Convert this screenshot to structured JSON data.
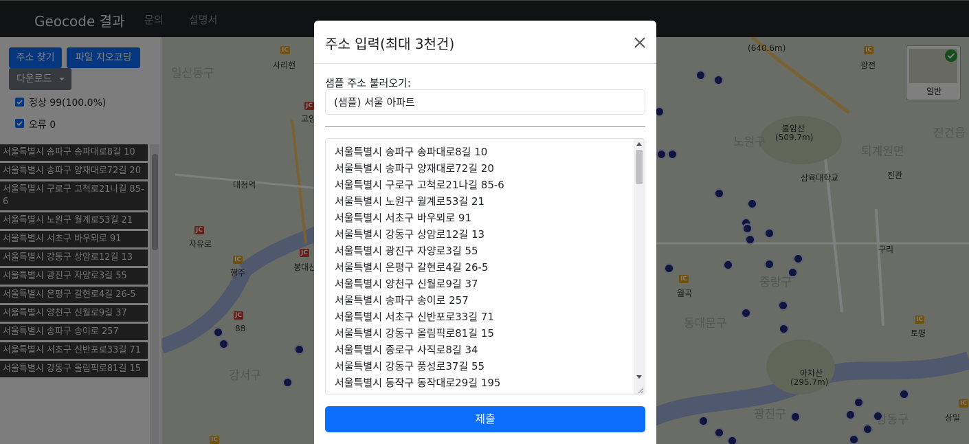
{
  "navbar": {
    "brand": "Geocode 결과",
    "links": [
      "문의",
      "설명서"
    ]
  },
  "sidebar": {
    "buttons": {
      "address_search": "주소 찾기",
      "file_geocoding": "파일 지오코딩",
      "download": "다운로드"
    },
    "filters": [
      {
        "label": "정상 99(100.0%)",
        "checked": true
      },
      {
        "label": "오류 0",
        "checked": true
      }
    ],
    "results": [
      "서울특별시 송파구 송파대로8길 10",
      "서울특별시 송파구 양재대로72길 20",
      "서울특별시 구로구 고척로21나길 85-6",
      "서울특별시 노원구 월계로53길 21",
      "서울특별시 서초구 바우뫼로 91",
      "서울특별시 강동구 상암로12길 13",
      "서울특별시 광진구 자양로3길 55",
      "서울특별시 은평구 갈현로4길 26-5",
      "서울특별시 양천구 신월로9길 37",
      "서울특별시 송파구 송이로 257",
      "서울특별시 서초구 신반포로33길 71",
      "서울특별시 강동구 올림픽로81길 15"
    ]
  },
  "map": {
    "labels": {
      "ilsan": "일산동구",
      "sari": "사리현",
      "goyang": "고양",
      "daejeong": "대정역",
      "jayuro": "자유로",
      "haengju": "행주",
      "bonghyeon": "봉대산",
      "r88": "88",
      "gangseo": "강서구",
      "nowon": "노원구",
      "bulam": "불암산",
      "bulam_h": "(509.7m)",
      "samyuk": "삼육대학교",
      "toegye": "퇴계원면",
      "jingwan": "진관",
      "gwangjeon": "광전",
      "sumak": "(640.6m)",
      "guri": "구리",
      "wolgok": "월곡",
      "jungnang": "중랑구",
      "dongdaemun": "동대문구",
      "topyeong": "토평",
      "acha": "아차산",
      "acha_h": "(295.7m)",
      "gwangjin": "광진구",
      "gangdong": "강동구",
      "sangil": "상일",
      "jingeon": "진건읍"
    },
    "map_type": "일반"
  },
  "modal": {
    "title": "주소 입력(최대 3천건)",
    "sample_label": "샘플 주소 불러오기:",
    "sample_selected": "(샘플) 서울 아파트",
    "lines": [
      "서울특별시 송파구 송파대로8길 10",
      "서울특별시 송파구 양재대로72길 20",
      "서울특별시 구로구 고척로21나길 85-6",
      "서울특별시 노원구 월계로53길 21",
      "서울특별시 서초구 바우뫼로 91",
      "서울특별시 강동구 상암로12길 13",
      "서울특별시 광진구 자양로3길 55",
      "서울특별시 은평구 갈현로4길 26-5",
      "서울특별시 양천구 신월로9길 37",
      "서울특별시 송파구 송이로 257",
      "서울특별시 서초구 신반포로33길 71",
      "서울특별시 강동구 올림픽로81길 15",
      "서울특별시 종로구 사직로8길 34",
      "서울특별시 강동구 풍성로37길 55",
      "서울특별시 동작구 동작대로29길 195"
    ],
    "submit": "제출"
  }
}
